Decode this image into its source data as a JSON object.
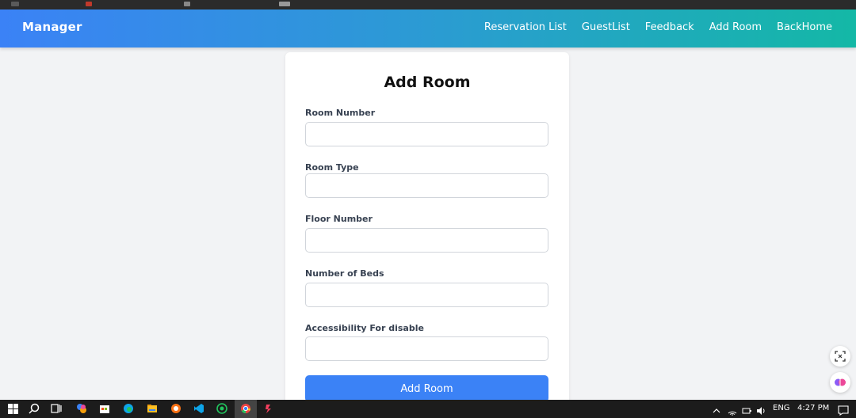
{
  "navbar": {
    "brand": "Manager",
    "links": [
      "Reservation List",
      "GuestList",
      "Feedback",
      "Add Room",
      "BackHome"
    ]
  },
  "form": {
    "title": "Add Room",
    "fields": [
      {
        "label": "Room Number",
        "value": ""
      },
      {
        "label": "Room Type",
        "value": ""
      },
      {
        "label": "Floor Number",
        "value": ""
      },
      {
        "label": "Number of Beds",
        "value": ""
      },
      {
        "label": "Accessibility For disable",
        "value": ""
      }
    ],
    "submit_label": "Add Room"
  },
  "taskbar": {
    "language": "ENG",
    "time": "4:27 PM",
    "icons": [
      "windows-start-icon",
      "search-icon",
      "task-view-icon",
      "copilot-icon",
      "store-icon",
      "edge-icon",
      "file-explorer-icon",
      "media-icon",
      "vscode-icon",
      "whatsapp-icon",
      "chrome-icon",
      "app-icon"
    ]
  },
  "colors": {
    "nav_gradient_start": "#3b82f6",
    "nav_gradient_end": "#14b8a6",
    "button": "#3b82f6",
    "background": "#f2f3f5"
  }
}
